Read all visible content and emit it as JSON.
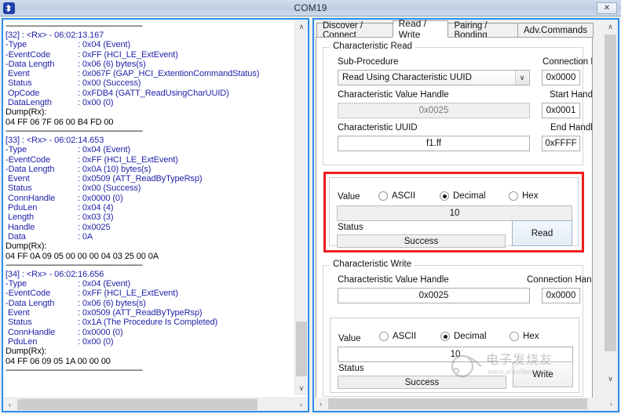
{
  "window": {
    "title": "COM19",
    "close_label": "✕",
    "app_icon": "bluetooth-icon"
  },
  "log": {
    "separator": "------------------------------------------------------------------------------------------",
    "entries": [
      {
        "header": "[32] : <Rx> - 06:02:13.167",
        "fields": [
          {
            "key": "-Type",
            "value": ": 0x04 (Event)"
          },
          {
            "key": "-EventCode",
            "value": ": 0xFF (HCI_LE_ExtEvent)"
          },
          {
            "key": "-Data Length",
            "value": ": 0x06 (6) bytes(s)"
          },
          {
            "key": " Event",
            "value": ": 0x067F (GAP_HCI_ExtentionCommandStatus)"
          },
          {
            "key": " Status",
            "value": ": 0x00 (Success)"
          },
          {
            "key": " OpCode",
            "value": ": 0xFDB4 (GATT_ReadUsingCharUUID)"
          },
          {
            "key": " DataLength",
            "value": ": 0x00 (0)"
          }
        ],
        "dump_label": "Dump(Rx):",
        "dump": "04 FF 06 7F 06 00 B4 FD 00"
      },
      {
        "header": "[33] : <Rx> - 06:02:14.653",
        "fields": [
          {
            "key": "-Type",
            "value": ": 0x04 (Event)"
          },
          {
            "key": "-EventCode",
            "value": ": 0xFF (HCI_LE_ExtEvent)"
          },
          {
            "key": "-Data Length",
            "value": ": 0x0A (10) bytes(s)"
          },
          {
            "key": " Event",
            "value": ": 0x0509 (ATT_ReadByTypeRsp)"
          },
          {
            "key": " Status",
            "value": ": 0x00 (Success)"
          },
          {
            "key": " ConnHandle",
            "value": ": 0x0000 (0)"
          },
          {
            "key": " PduLen",
            "value": ": 0x04 (4)"
          },
          {
            "key": " Length",
            "value": ": 0x03 (3)"
          },
          {
            "key": " Handle",
            "value": ": 0x0025"
          },
          {
            "key": " Data",
            "value": ": 0A"
          }
        ],
        "dump_label": "Dump(Rx):",
        "dump": "04 FF 0A 09 05 00 00 00 04 03 25 00 0A"
      },
      {
        "header": "[34] : <Rx> - 06:02:16.656",
        "fields": [
          {
            "key": "-Type",
            "value": ": 0x04 (Event)"
          },
          {
            "key": "-EventCode",
            "value": ": 0xFF (HCI_LE_ExtEvent)"
          },
          {
            "key": "-Data Length",
            "value": ": 0x06 (6) bytes(s)"
          },
          {
            "key": " Event",
            "value": ": 0x0509 (ATT_ReadByTypeRsp)"
          },
          {
            "key": " Status",
            "value": ": 0x1A (The Procedure Is Completed)"
          },
          {
            "key": " ConnHandle",
            "value": ": 0x0000 (0)"
          },
          {
            "key": " PduLen",
            "value": ": 0x00 (0)"
          }
        ],
        "dump_label": "Dump(Rx):",
        "dump": "04 FF 06 09 05 1A 00 00 00"
      }
    ]
  },
  "tabs": [
    {
      "label": "Discover / Connect",
      "active": false
    },
    {
      "label": "Read / Write",
      "active": true
    },
    {
      "label": "Pairing / Bonding",
      "active": false
    },
    {
      "label": "Adv.Commands",
      "active": false
    }
  ],
  "characteristic_read": {
    "legend": "Characteristic Read",
    "sub_procedure_label": "Sub-Procedure",
    "sub_procedure_value": "Read Using Characteristic UUID",
    "connection_handle_label": "Connection Handle",
    "connection_handle_value": "0x0000",
    "char_value_handle_label": "Characteristic Value Handle",
    "char_value_handle_value": "0x0025",
    "start_handle_label": "Start Handle",
    "start_handle_value": "0x0001",
    "char_uuid_label": "Characteristic UUID",
    "char_uuid_value": "f1.ff",
    "end_handle_label": "End Handle",
    "end_handle_value": "0xFFFF",
    "value_label": "Value",
    "formats": [
      {
        "label": "ASCII",
        "selected": false
      },
      {
        "label": "Decimal",
        "selected": true
      },
      {
        "label": "Hex",
        "selected": false
      }
    ],
    "value_text": "10",
    "status_label": "Status",
    "status_value": "Success",
    "read_button": "Read"
  },
  "characteristic_write": {
    "legend": "Characteristic Write",
    "char_value_handle_label": "Characteristic Value Handle",
    "char_value_handle_value": "0x0025",
    "connection_handle_label": "Connection Handle",
    "connection_handle_value": "0x0000",
    "value_label": "Value",
    "formats": [
      {
        "label": "ASCII",
        "selected": false
      },
      {
        "label": "Decimal",
        "selected": true
      },
      {
        "label": "Hex",
        "selected": false
      }
    ],
    "value_text": "10",
    "status_label": "Status",
    "status_value": "Success",
    "write_button": "Write"
  },
  "scrollbars": {
    "up_arrow": "∧",
    "down_arrow": "∨",
    "left_arrow": "‹",
    "right_arrow": "›"
  },
  "watermark": {
    "text": "电子发烧友",
    "sub": "www.elecfans.com"
  },
  "colors": {
    "accent_border": "#2a8ef0",
    "highlight_red": "#ee1c1c",
    "log_text": "#1f1faa",
    "titlebar": "#c4d3e6"
  }
}
